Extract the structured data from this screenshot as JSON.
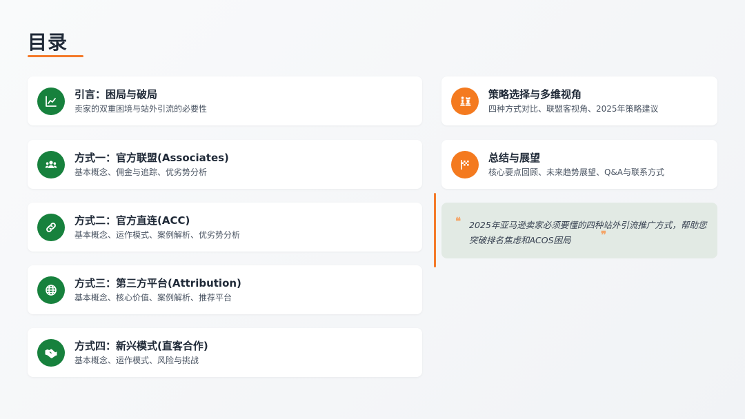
{
  "page": {
    "title": "目录"
  },
  "toc_left": [
    {
      "icon": "chart-line-icon",
      "title": "引言：困局与破局",
      "subtitle": "卖家的双重困境与站外引流的必要性"
    },
    {
      "icon": "users-icon",
      "title": "方式一：官方联盟(Associates)",
      "subtitle": "基本概念、佣金与追踪、优劣势分析"
    },
    {
      "icon": "link-icon",
      "title": "方式二：官方直连(ACC)",
      "subtitle": "基本概念、运作模式、案例解析、优劣势分析"
    },
    {
      "icon": "globe-icon",
      "title": "方式三：第三方平台(Attribution)",
      "subtitle": "基本概念、核心价值、案例解析、推荐平台"
    },
    {
      "icon": "handshake-icon",
      "title": "方式四：新兴模式(直客合作)",
      "subtitle": "基本概念、运作模式、风险与挑战"
    }
  ],
  "toc_right": [
    {
      "icon": "chess-icon",
      "title": "策略选择与多维视角",
      "subtitle": "四种方式对比、联盟客视角、2025年策略建议"
    },
    {
      "icon": "flag-checkered-icon",
      "title": "总结与展望",
      "subtitle": "核心要点回顾、未来趋势展望、Q&A与联系方式"
    }
  ],
  "quote": {
    "open_mark": "❝",
    "close_mark": "❞",
    "text": "2025年亚马逊卖家必须要懂的四种站外引流推广方式，帮助您突破排名焦虑和ACOS困局"
  },
  "colors": {
    "accent_orange": "#f47a2a",
    "icon_green": "#17813d",
    "icon_orange": "#f47a1f",
    "quote_bg": "#e2eae4"
  }
}
